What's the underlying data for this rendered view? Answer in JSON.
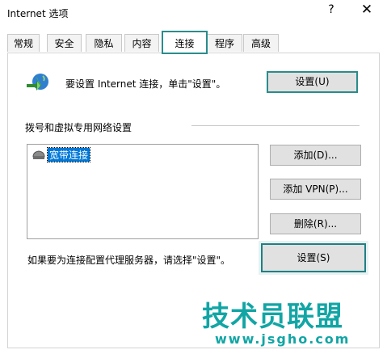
{
  "window": {
    "title": "Internet 选项",
    "help": "?",
    "close": "✕"
  },
  "tabs": [
    "常规",
    "安全",
    "隐私",
    "内容",
    "连接",
    "程序",
    "高级"
  ],
  "active_tab": "连接",
  "setup": {
    "text": "要设置 Internet 连接，单击\"设置\"。",
    "button": "设置(U)"
  },
  "dialup": {
    "heading": "拨号和虚拟专用网络设置",
    "items": [
      "宽带连接"
    ],
    "add": "添加(D)...",
    "add_vpn": "添加 VPN(P)...",
    "remove": "删除(R)..."
  },
  "proxy": {
    "text": "如果要为连接配置代理服务器，请选择\"设置\"。",
    "button": "设置(S)"
  },
  "watermark": {
    "title": "技术员联盟",
    "url": "www.jsgho.com"
  },
  "colors": {
    "highlight_border": "#2b8c8c",
    "selection": "#0078d7",
    "watermark": "#12a5a5"
  }
}
